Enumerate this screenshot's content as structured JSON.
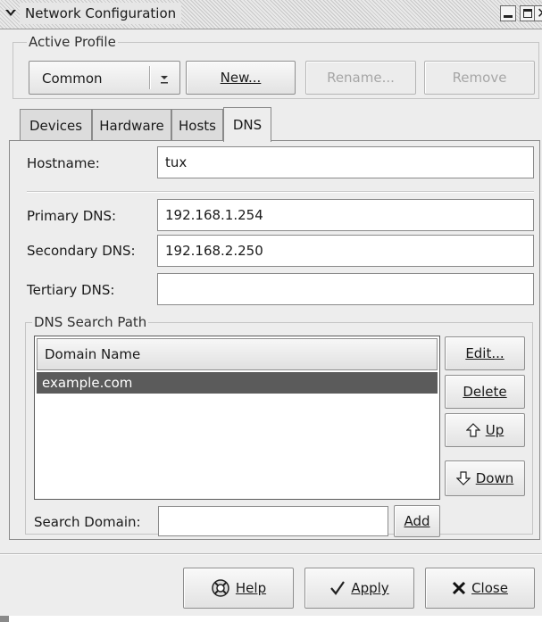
{
  "window": {
    "title": "Network Configuration"
  },
  "active_profile": {
    "group_label": "Active Profile",
    "selected": "Common",
    "new_label": "New...",
    "rename_label": "Rename...",
    "remove_label": "Remove"
  },
  "tabs": [
    {
      "label": "Devices"
    },
    {
      "label": "Hardware"
    },
    {
      "label": "Hosts"
    },
    {
      "label": "DNS"
    }
  ],
  "dns": {
    "hostname_label": "Hostname:",
    "hostname_value": "tux",
    "primary_label": "Primary DNS:",
    "primary_value": "192.168.1.254",
    "secondary_label": "Secondary DNS:",
    "secondary_value": "192.168.2.250",
    "tertiary_label": "Tertiary DNS:",
    "tertiary_value": ""
  },
  "search_path": {
    "group_label": "DNS Search Path",
    "column_header": "Domain Name",
    "rows": [
      "example.com"
    ],
    "edit_label": "Edit...",
    "delete_label": "Delete",
    "up_label": "Up",
    "down_label": "Down",
    "search_domain_label": "Search Domain:",
    "search_domain_value": "",
    "add_label": "Add"
  },
  "footer": {
    "help_label": "Help",
    "apply_label": "Apply",
    "close_label": "Close"
  },
  "colors": {
    "window_bg": "#ededed",
    "selection": "#5b5b5b"
  }
}
